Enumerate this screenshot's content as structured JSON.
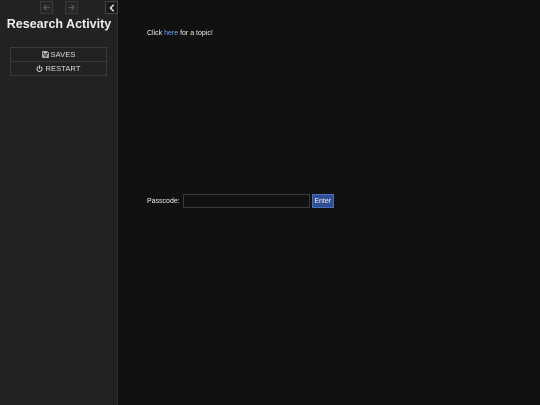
{
  "sidebar": {
    "title": "Research Activity",
    "history": {
      "back_icon": "arrow-left-icon",
      "forward_icon": "arrow-right-icon"
    },
    "collapse_icon": "chevron-left-icon",
    "menu": {
      "saves_label": "SAVES",
      "saves_icon": "floppy-disk-icon",
      "restart_label": "RESTART",
      "restart_icon": "power-icon"
    }
  },
  "passage": {
    "prompt_before": "Click ",
    "prompt_link": "here",
    "prompt_after": " for a topic!",
    "passcode_label": "Passcode:",
    "passcode_value": "",
    "enter_label": "Enter"
  },
  "colors": {
    "background": "#111111",
    "sidebar_background": "#222222",
    "link": "#68a5ff",
    "button_accent": "#2f4f95"
  }
}
